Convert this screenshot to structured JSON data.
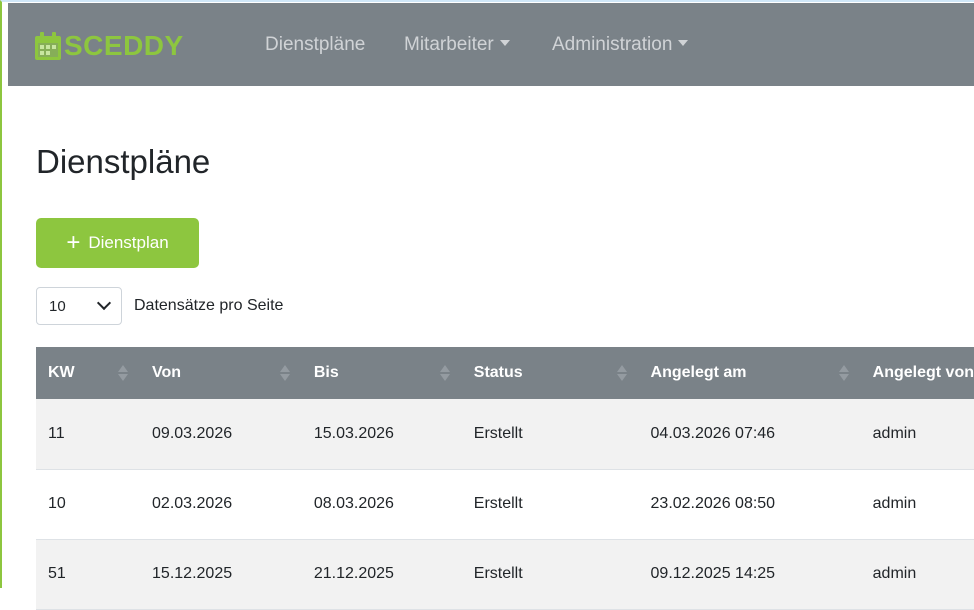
{
  "app": {
    "brand": "SCEDDY",
    "colors": {
      "accent": "#8dc63f",
      "navbar": "#7a8288",
      "nav_text": "#d0d3d6"
    }
  },
  "nav": {
    "items": [
      {
        "label": "Dienstpläne",
        "dropdown": false
      },
      {
        "label": "Mitarbeiter",
        "dropdown": true
      },
      {
        "label": "Administration",
        "dropdown": true
      }
    ]
  },
  "page": {
    "title": "Dienstpläne",
    "add_button_label": "Dienstplan",
    "add_button_icon": "plus-icon"
  },
  "length": {
    "value": "10",
    "label": "Datensätze pro Seite"
  },
  "table": {
    "columns": [
      "KW",
      "Von",
      "Bis",
      "Status",
      "Angelegt am",
      "Angelegt von"
    ],
    "rows": [
      [
        "11",
        "09.03.2026",
        "15.03.2026",
        "Erstellt",
        "04.03.2026 07:46",
        "admin"
      ],
      [
        "10",
        "02.03.2026",
        "08.03.2026",
        "Erstellt",
        "23.02.2026 08:50",
        "admin"
      ],
      [
        "51",
        "15.12.2025",
        "21.12.2025",
        "Erstellt",
        "09.12.2025 14:25",
        "admin"
      ]
    ]
  }
}
